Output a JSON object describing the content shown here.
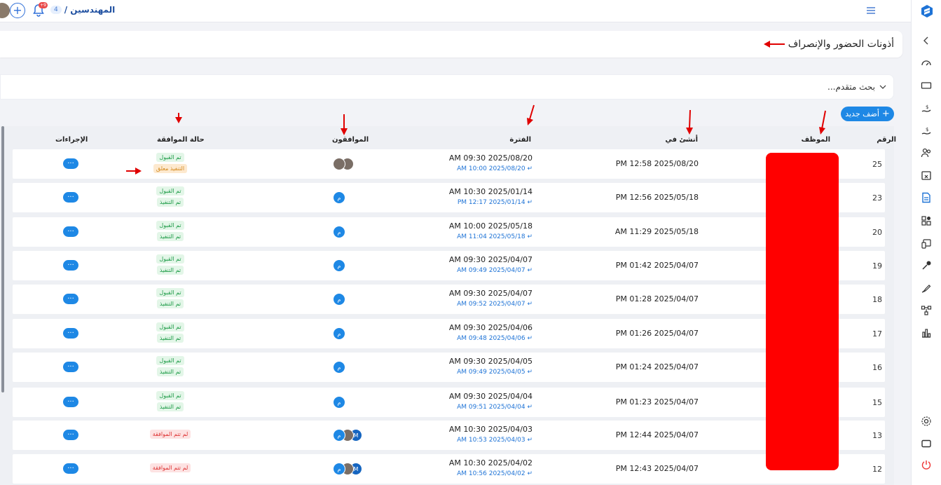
{
  "header": {
    "breadcrumb_label": "المهندسين /",
    "breadcrumb_count": "4",
    "notif_count": "+9"
  },
  "page": {
    "title": "أذونات الحضور والإنصراف",
    "advanced_search": "بحث متقدم...",
    "add_button": "أضف جديد"
  },
  "table": {
    "columns": {
      "id": "الرقم",
      "employee": "الموظف",
      "created_at": "أنشئ في",
      "period": "الفترة",
      "approvers": "الموافقون",
      "status": "حالة الموافقة",
      "actions": "الإجراءات"
    },
    "rows": [
      {
        "id": "25",
        "created": "2025/08/20 12:58 PM",
        "start": "2025/08/20 09:30 AM",
        "end": "2025/08/20 10:00 AM",
        "approvers": [
          "ph",
          "ph"
        ],
        "statuses": [
          {
            "text": "تم القبول",
            "kind": "green"
          },
          {
            "text": "التنفيذ معلق",
            "kind": "orange"
          }
        ]
      },
      {
        "id": "23",
        "created": "2025/05/18 12:56 PM",
        "start": "2025/01/14 10:30 AM",
        "end": "2025/01/14 12:17 PM",
        "approvers": [
          "م"
        ],
        "statuses": [
          {
            "text": "تم القبول",
            "kind": "green"
          },
          {
            "text": "تم التنفيذ",
            "kind": "green"
          }
        ]
      },
      {
        "id": "20",
        "created": "2025/05/18 11:29 AM",
        "start": "2025/05/18 10:00 AM",
        "end": "2025/05/18 11:04 AM",
        "approvers": [
          "م"
        ],
        "statuses": [
          {
            "text": "تم القبول",
            "kind": "green"
          },
          {
            "text": "تم التنفيذ",
            "kind": "green"
          }
        ]
      },
      {
        "id": "19",
        "created": "2025/04/07 01:42 PM",
        "start": "2025/04/07 09:30 AM",
        "end": "2025/04/07 09:49 AM",
        "approvers": [
          "م"
        ],
        "statuses": [
          {
            "text": "تم القبول",
            "kind": "green"
          },
          {
            "text": "تم التنفيذ",
            "kind": "green"
          }
        ]
      },
      {
        "id": "18",
        "created": "2025/04/07 01:28 PM",
        "start": "2025/04/07 09:30 AM",
        "end": "2025/04/07 09:52 AM",
        "approvers": [
          "م"
        ],
        "statuses": [
          {
            "text": "تم القبول",
            "kind": "green"
          },
          {
            "text": "تم التنفيذ",
            "kind": "green"
          }
        ]
      },
      {
        "id": "17",
        "created": "2025/04/07 01:26 PM",
        "start": "2025/04/06 09:30 AM",
        "end": "2025/04/06 09:48 AM",
        "approvers": [
          "م"
        ],
        "statuses": [
          {
            "text": "تم القبول",
            "kind": "green"
          },
          {
            "text": "تم التنفيذ",
            "kind": "green"
          }
        ]
      },
      {
        "id": "16",
        "created": "2025/04/07 01:24 PM",
        "start": "2025/04/05 09:30 AM",
        "end": "2025/04/05 09:49 AM",
        "approvers": [
          "م"
        ],
        "statuses": [
          {
            "text": "تم القبول",
            "kind": "green"
          },
          {
            "text": "تم التنفيذ",
            "kind": "green"
          }
        ]
      },
      {
        "id": "15",
        "created": "2025/04/07 01:23 PM",
        "start": "2025/04/04 09:30 AM",
        "end": "2025/04/04 09:51 AM",
        "approvers": [
          "م"
        ],
        "statuses": [
          {
            "text": "تم القبول",
            "kind": "green"
          },
          {
            "text": "تم التنفيذ",
            "kind": "green"
          }
        ]
      },
      {
        "id": "13",
        "created": "2025/04/07 12:44 PM",
        "start": "2025/04/03 10:30 AM",
        "end": "2025/04/03 10:53 AM",
        "approvers": [
          "م",
          "ph",
          "M"
        ],
        "statuses": [
          {
            "text": "لم تتم الموافقة",
            "kind": "red"
          }
        ]
      },
      {
        "id": "12",
        "created": "2025/04/07 12:43 PM",
        "start": "2025/04/02 10:30 AM",
        "end": "2025/04/02 10:56 AM",
        "approvers": [
          "م",
          "ph",
          "M"
        ],
        "statuses": [
          {
            "text": "لم تتم الموافقة",
            "kind": "red"
          }
        ]
      }
    ],
    "action_label": "···"
  },
  "colors": {
    "accent": "#1e88e5",
    "annotation": "#e00000",
    "redaction": "#ff0000"
  }
}
